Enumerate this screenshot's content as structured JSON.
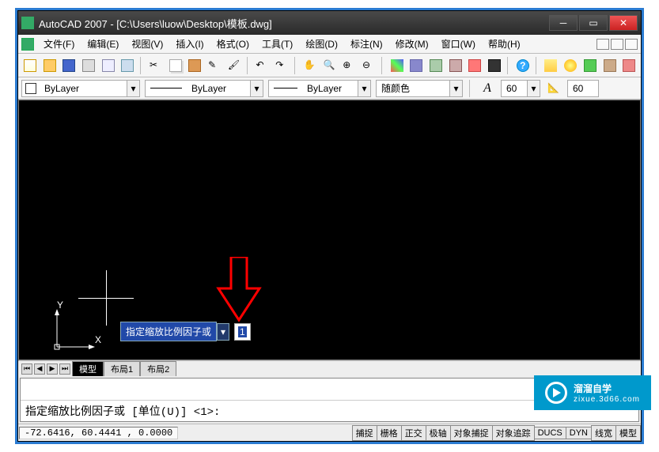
{
  "title": "AutoCAD 2007 - [C:\\Users\\luow\\Desktop\\模板.dwg]",
  "menu": {
    "file": "文件(F)",
    "edit": "编辑(E)",
    "view": "视图(V)",
    "insert": "插入(I)",
    "format": "格式(O)",
    "tools": "工具(T)",
    "draw": "绘图(D)",
    "dim": "标注(N)",
    "modify": "修改(M)",
    "window": "窗口(W)",
    "help": "帮助(H)"
  },
  "prop": {
    "layer": "ByLayer",
    "ltype": "ByLayer",
    "lweight": "ByLayer",
    "color": "随颜色",
    "angle": "60",
    "scale": "60"
  },
  "dyn": {
    "label": "指定缩放比例因子或",
    "value": "1"
  },
  "tabs": {
    "model": "模型",
    "layout1": "布局1",
    "layout2": "布局2"
  },
  "cmd": {
    "prompt": "指定缩放比例因子或 [单位(U)] <1>:"
  },
  "status": {
    "coords": "-72.6416, 60.4441 , 0.0000",
    "snap": "捕捉",
    "grid": "栅格",
    "ortho": "正交",
    "polar": "极轴",
    "osnap": "对象捕捉",
    "otrack": "对象追踪",
    "ducs": "DUCS",
    "dyn": "DYN",
    "lwt": "线宽",
    "model": "模型"
  },
  "ucs": {
    "y": "Y",
    "x": "X"
  },
  "watermark": {
    "t1": "溜溜自学",
    "t2": "zixue.3d66.com"
  }
}
